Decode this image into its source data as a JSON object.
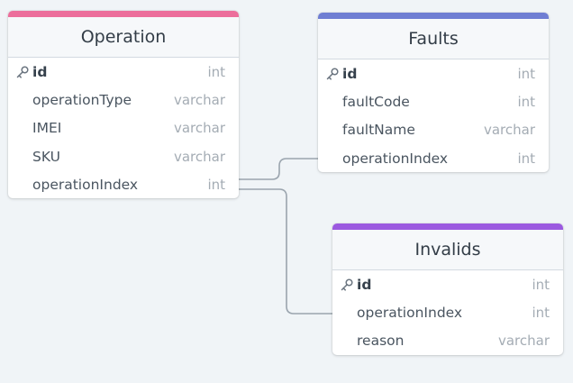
{
  "theme": {
    "background": "#f0f4f7",
    "connector_color": "#9aa4ae"
  },
  "tables": {
    "operation": {
      "title": "Operation",
      "accent": "#ec6e9b",
      "fields": [
        {
          "name": "id",
          "type": "int",
          "primary": true
        },
        {
          "name": "operationType",
          "type": "varchar",
          "primary": false
        },
        {
          "name": "IMEI",
          "type": "varchar",
          "primary": false
        },
        {
          "name": "SKU",
          "type": "varchar",
          "primary": false
        },
        {
          "name": "operationIndex",
          "type": "int",
          "primary": false
        }
      ]
    },
    "faults": {
      "title": "Faults",
      "accent": "#6f7ed3",
      "fields": [
        {
          "name": "id",
          "type": "int",
          "primary": true
        },
        {
          "name": "faultCode",
          "type": "int",
          "primary": false
        },
        {
          "name": "faultName",
          "type": "varchar",
          "primary": false
        },
        {
          "name": "operationIndex",
          "type": "int",
          "primary": false
        }
      ]
    },
    "invalids": {
      "title": "Invalids",
      "accent": "#9b59e0",
      "fields": [
        {
          "name": "id",
          "type": "int",
          "primary": true
        },
        {
          "name": "operationIndex",
          "type": "int",
          "primary": false
        },
        {
          "name": "reason",
          "type": "varchar",
          "primary": false
        }
      ]
    }
  },
  "relations": [
    {
      "from": "Operation.operationIndex",
      "to": "Faults.operationIndex"
    },
    {
      "from": "Operation.operationIndex",
      "to": "Invalids.operationIndex"
    }
  ]
}
